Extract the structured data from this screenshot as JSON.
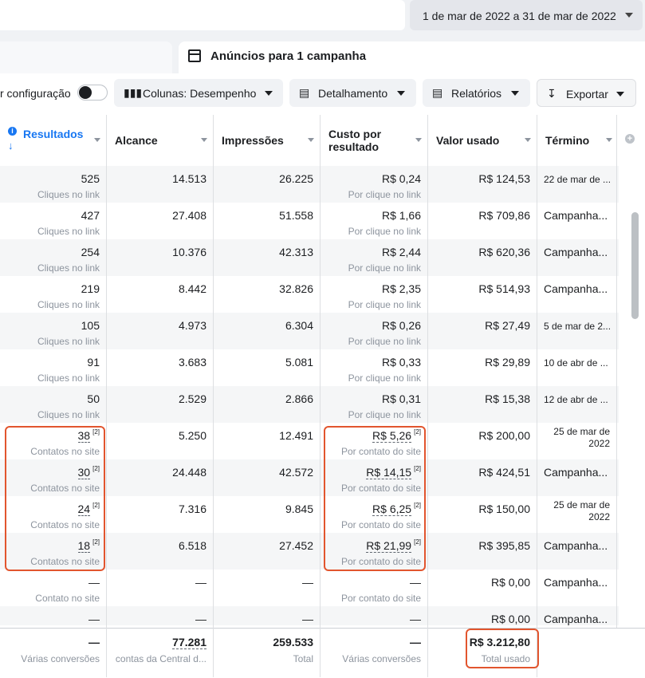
{
  "date_range": {
    "label": "1 de mar de 2022 a 31 de mar de 2022"
  },
  "tab": {
    "title": "Anúncios para 1 campanha"
  },
  "toolbar": {
    "config_label": "r configuração",
    "columns_label": "Colunas: Desempenho",
    "breakdown_label": "Detalhamento",
    "reports_label": "Relatórios",
    "export_label": "Exportar"
  },
  "table": {
    "headers": {
      "resultados": "Resultados",
      "alcance": "Alcance",
      "impressoes": "Impressões",
      "custo_l1": "Custo por",
      "custo_l2": "resultado",
      "valor": "Valor usado",
      "termino": "Término"
    },
    "rows": [
      {
        "res": "525",
        "res_sub": "Cliques no link",
        "alc": "14.513",
        "imp": "26.225",
        "cpr": "R$ 0,24",
        "cpr_sub": "Por clique no link",
        "val": "R$ 124,53",
        "end": "22 de mar de ..."
      },
      {
        "res": "427",
        "res_sub": "Cliques no link",
        "alc": "27.408",
        "imp": "51.558",
        "cpr": "R$ 1,66",
        "cpr_sub": "Por clique no link",
        "val": "R$ 709,86",
        "end": "Campanha..."
      },
      {
        "res": "254",
        "res_sub": "Cliques no link",
        "alc": "10.376",
        "imp": "42.313",
        "cpr": "R$ 2,44",
        "cpr_sub": "Por clique no link",
        "val": "R$ 620,36",
        "end": "Campanha..."
      },
      {
        "res": "219",
        "res_sub": "Cliques no link",
        "alc": "8.442",
        "imp": "32.826",
        "cpr": "R$ 2,35",
        "cpr_sub": "Por clique no link",
        "val": "R$ 514,93",
        "end": "Campanha..."
      },
      {
        "res": "105",
        "res_sub": "Cliques no link",
        "alc": "4.973",
        "imp": "6.304",
        "cpr": "R$ 0,26",
        "cpr_sub": "Por clique no link",
        "val": "R$ 27,49",
        "end": "5 de mar de 2..."
      },
      {
        "res": "91",
        "res_sub": "Cliques no link",
        "alc": "3.683",
        "imp": "5.081",
        "cpr": "R$ 0,33",
        "cpr_sub": "Por clique no link",
        "val": "R$ 29,89",
        "end": "10 de abr de ..."
      },
      {
        "res": "50",
        "res_sub": "Cliques no link",
        "alc": "2.529",
        "imp": "2.866",
        "cpr": "R$ 0,31",
        "cpr_sub": "Por clique no link",
        "val": "R$ 15,38",
        "end": "12 de abr de ..."
      },
      {
        "res": "38",
        "res_sub": "Contatos no site",
        "alc": "5.250",
        "imp": "12.491",
        "cpr": "R$ 5,26",
        "cpr_sub": "Por contato do site",
        "val": "R$ 200,00",
        "end": "25 de mar de 2022"
      },
      {
        "res": "30",
        "res_sub": "Contatos no site",
        "alc": "24.448",
        "imp": "42.572",
        "cpr": "R$ 14,15",
        "cpr_sub": "Por contato do site",
        "val": "R$ 424,51",
        "end": "Campanha..."
      },
      {
        "res": "24",
        "res_sub": "Contatos no site",
        "alc": "7.316",
        "imp": "9.845",
        "cpr": "R$ 6,25",
        "cpr_sub": "Por contato do site",
        "val": "R$ 150,00",
        "end": "25 de mar de 2022"
      },
      {
        "res": "18",
        "res_sub": "Contatos no site",
        "alc": "6.518",
        "imp": "27.452",
        "cpr": "R$ 21,99",
        "cpr_sub": "Por contato do site",
        "val": "R$ 395,85",
        "end": "Campanha..."
      },
      {
        "res": "—",
        "res_sub": "Contato no site",
        "alc": "—",
        "imp": "—",
        "cpr": "—",
        "cpr_sub": "Por contato do site",
        "val": "R$ 0,00",
        "end": "Campanha..."
      },
      {
        "res": "—",
        "res_sub": "",
        "alc": "—",
        "imp": "—",
        "cpr": "—",
        "cpr_sub": "",
        "val": "R$ 0,00",
        "end": "Campanha..."
      }
    ],
    "footnote_mark": "[2]",
    "totals": {
      "res": "—",
      "res_sub": "Várias conversões",
      "alc": "77.281",
      "alc_sub": "contas da Central d...",
      "imp": "259.533",
      "imp_sub": "Total",
      "cpr": "—",
      "cpr_sub": "Várias conversões",
      "val": "R$ 3.212,80",
      "val_sub": "Total usado"
    }
  },
  "colors": {
    "highlight": "#e2552e",
    "accent": "#1877f2"
  }
}
